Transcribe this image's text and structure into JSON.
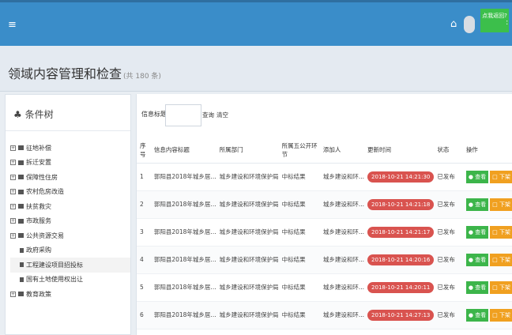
{
  "topbar": {
    "menu_icon": "≡",
    "home_icon": "⌂",
    "notice": "点我返回?",
    "sep": ":"
  },
  "page": {
    "title": "领域内容管理和检查",
    "count": "(共 180 条)"
  },
  "sidebar": {
    "header": "条件树",
    "items": [
      {
        "label": "征地补偿",
        "level": 0
      },
      {
        "label": "拆迁安置",
        "level": 0
      },
      {
        "label": "保障性住房",
        "level": 0
      },
      {
        "label": "农村危房改造",
        "level": 0
      },
      {
        "label": "扶贫救灾",
        "level": 0
      },
      {
        "label": "市政服务",
        "level": 0
      },
      {
        "label": "公共资源交易",
        "level": 0
      },
      {
        "label": "政府采购",
        "level": 1
      },
      {
        "label": "工程建设项目招投标",
        "level": 1,
        "selected": true
      },
      {
        "label": "国有土地使用权出让",
        "level": 1
      },
      {
        "label": "教育政策",
        "level": 0
      }
    ]
  },
  "search": {
    "label": "信息标题",
    "value": "",
    "search_btn": "查询",
    "reset_btn": "清空"
  },
  "table": {
    "headers": [
      "序号",
      "信息内容标题",
      "所属部门",
      "所属五公开环节",
      "添加人",
      "更新时间",
      "状态",
      "操作"
    ],
    "rows": [
      {
        "num": "1",
        "title": "郭阳县2018年城乡居...",
        "dept": "城乡建设和环境保护局",
        "stage": "中标结果",
        "adder": "城乡建设和环...",
        "time": "2018-10-21 14:21:30",
        "status": "已发布"
      },
      {
        "num": "2",
        "title": "郭阳县2018年城乡居...",
        "dept": "城乡建设和环境保护局",
        "stage": "中标结果",
        "adder": "城乡建设和环...",
        "time": "2018-10-21 14:21:18",
        "status": "已发布"
      },
      {
        "num": "3",
        "title": "郭阳县2018年城乡居...",
        "dept": "城乡建设和环境保护局",
        "stage": "中标结果",
        "adder": "城乡建设和环...",
        "time": "2018-10-21 14:21:17",
        "status": "已发布"
      },
      {
        "num": "4",
        "title": "郭阳县2018年城乡居...",
        "dept": "城乡建设和环境保护局",
        "stage": "中标结果",
        "adder": "城乡建设和环...",
        "time": "2018-10-21 14:20:16",
        "status": "已发布"
      },
      {
        "num": "5",
        "title": "郭阳县2018年城乡居...",
        "dept": "城乡建设和环境保护局",
        "stage": "中标结果",
        "adder": "城乡建设和环...",
        "time": "2018-10-21 14:20:11",
        "status": "已发布"
      },
      {
        "num": "6",
        "title": "郭阳县2018年城乡居...",
        "dept": "城乡建设和环境保护局",
        "stage": "中标结果",
        "adder": "城乡建设和环...",
        "time": "2018-10-21 14:27:13",
        "status": "已发布"
      }
    ],
    "view_label": "查看",
    "down_label": "下架"
  }
}
